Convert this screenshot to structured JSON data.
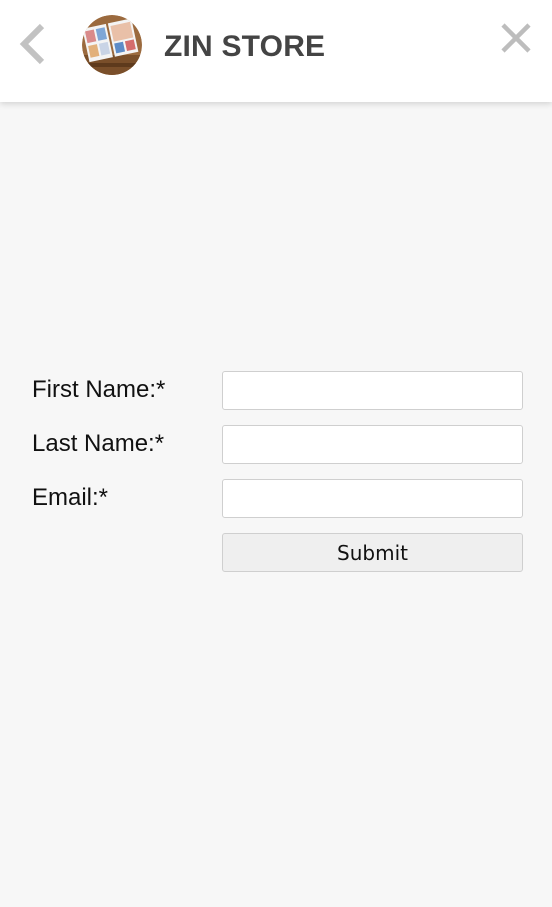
{
  "header": {
    "title": "ZIN STORE",
    "back_icon": "chevron-left-icon",
    "close_icon": "close-icon",
    "avatar": "store-logo-avatar"
  },
  "form": {
    "first_name": {
      "label": "First Name:*",
      "value": ""
    },
    "last_name": {
      "label": "Last Name:*",
      "value": ""
    },
    "email": {
      "label": "Email:*",
      "value": ""
    },
    "submit_label": "Submit"
  },
  "colors": {
    "background": "#f7f7f7",
    "header_bg": "#ffffff",
    "title": "#444444",
    "icon": "#bdbdbd",
    "button_bg": "#efefef",
    "input_border": "#cfcfcf"
  }
}
